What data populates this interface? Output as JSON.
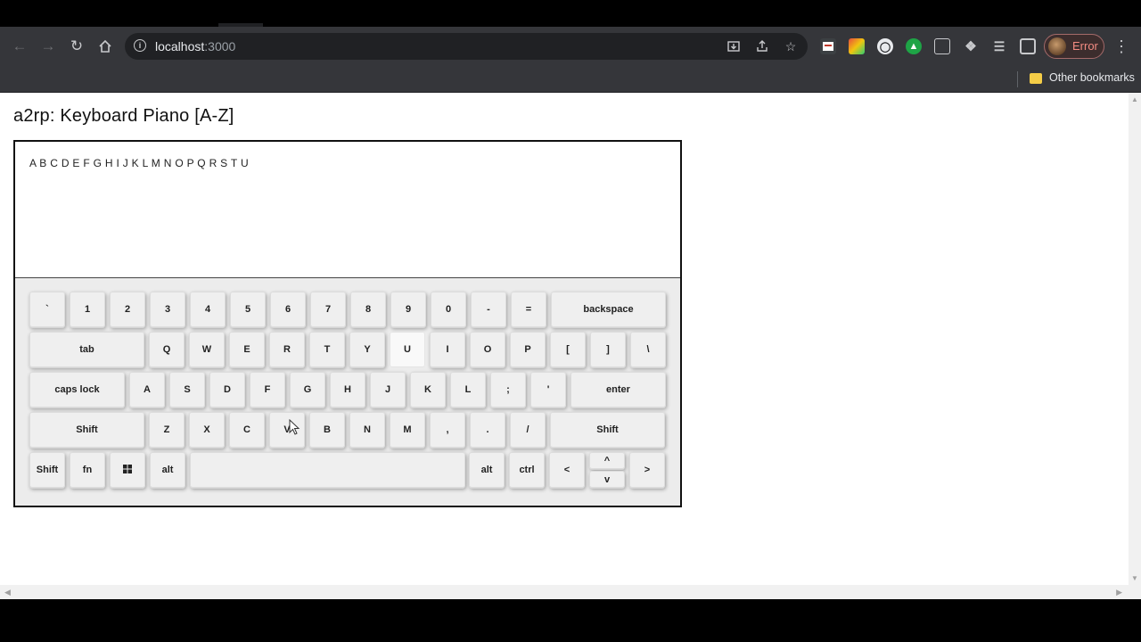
{
  "browser": {
    "url_host": "localhost",
    "url_port": ":3000",
    "profile_label": "Error",
    "bookmark_folder": "Other bookmarks",
    "accent_error": "#f28b82"
  },
  "page": {
    "title": "a2rp: Keyboard Piano [A-Z]",
    "notes_played": "A B C D E F G H I J K L M N O P Q R S T U"
  },
  "keyboard": {
    "row1": [
      "`",
      "1",
      "2",
      "3",
      "4",
      "5",
      "6",
      "7",
      "8",
      "9",
      "0",
      "-",
      "=",
      "backspace"
    ],
    "row2": [
      "tab",
      "Q",
      "W",
      "E",
      "R",
      "T",
      "Y",
      "U",
      "I",
      "O",
      "P",
      "[",
      "]",
      "\\"
    ],
    "row3": [
      "caps lock",
      "A",
      "S",
      "D",
      "F",
      "G",
      "H",
      "J",
      "K",
      "L",
      ";",
      "'",
      "enter"
    ],
    "row4": [
      "Shift",
      "Z",
      "X",
      "C",
      "V",
      "B",
      "N",
      "M",
      ",",
      ".",
      "/",
      "Shift"
    ],
    "row5": [
      "Shift",
      "fn",
      "win-icon",
      "alt",
      "",
      "alt",
      "ctrl",
      "<",
      "^",
      "v",
      ">"
    ],
    "pressed_key": "U"
  }
}
